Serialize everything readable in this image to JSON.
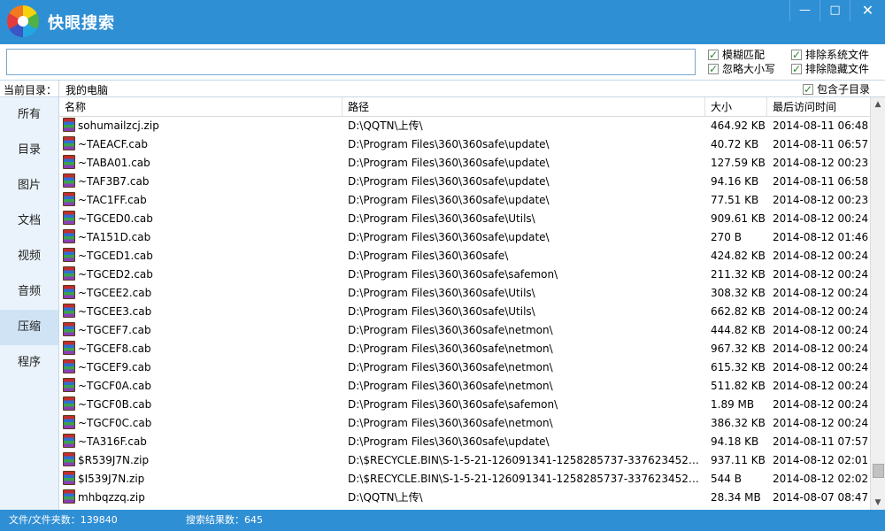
{
  "window": {
    "title": "快眼搜索",
    "controls": {
      "minimize": "—",
      "maximize": "□",
      "close": "✕"
    }
  },
  "search": {
    "value": "",
    "options": [
      {
        "label": "模糊匹配",
        "checked": true
      },
      {
        "label": "排除系统文件",
        "checked": true
      },
      {
        "label": "忽略大小写",
        "checked": true
      },
      {
        "label": "排除隐藏文件",
        "checked": true
      }
    ]
  },
  "directory": {
    "label": "当前目录：",
    "value": "我的电脑",
    "include_subdirs": {
      "label": "包含子目录",
      "checked": true
    }
  },
  "sidebar": {
    "items": [
      {
        "label": "所有"
      },
      {
        "label": "目录"
      },
      {
        "label": "图片"
      },
      {
        "label": "文档"
      },
      {
        "label": "视频"
      },
      {
        "label": "音频"
      },
      {
        "label": "压缩",
        "active": true
      },
      {
        "label": "程序"
      }
    ]
  },
  "table": {
    "columns": [
      "名称",
      "路径",
      "大小",
      "最后访问时间"
    ],
    "rows": [
      [
        "sohumailzcj.zip",
        "D:\\QQTN\\上传\\",
        "464.92 KB",
        "2014-08-11 06:48"
      ],
      [
        "~TAEACF.cab",
        "D:\\Program Files\\360\\360safe\\update\\",
        "40.72 KB",
        "2014-08-11 06:57"
      ],
      [
        "~TABA01.cab",
        "D:\\Program Files\\360\\360safe\\update\\",
        "127.59 KB",
        "2014-08-12 00:23"
      ],
      [
        "~TAF3B7.cab",
        "D:\\Program Files\\360\\360safe\\update\\",
        "94.16 KB",
        "2014-08-11 06:58"
      ],
      [
        "~TAC1FF.cab",
        "D:\\Program Files\\360\\360safe\\update\\",
        "77.51 KB",
        "2014-08-12 00:23"
      ],
      [
        "~TGCED0.cab",
        "D:\\Program Files\\360\\360safe\\Utils\\",
        "909.61 KB",
        "2014-08-12 00:24"
      ],
      [
        "~TA151D.cab",
        "D:\\Program Files\\360\\360safe\\update\\",
        "270 B",
        "2014-08-12 01:46"
      ],
      [
        "~TGCED1.cab",
        "D:\\Program Files\\360\\360safe\\",
        "424.82 KB",
        "2014-08-12 00:24"
      ],
      [
        "~TGCED2.cab",
        "D:\\Program Files\\360\\360safe\\safemon\\",
        "211.32 KB",
        "2014-08-12 00:24"
      ],
      [
        "~TGCEE2.cab",
        "D:\\Program Files\\360\\360safe\\Utils\\",
        "308.32 KB",
        "2014-08-12 00:24"
      ],
      [
        "~TGCEE3.cab",
        "D:\\Program Files\\360\\360safe\\Utils\\",
        "662.82 KB",
        "2014-08-12 00:24"
      ],
      [
        "~TGCEF7.cab",
        "D:\\Program Files\\360\\360safe\\netmon\\",
        "444.82 KB",
        "2014-08-12 00:24"
      ],
      [
        "~TGCEF8.cab",
        "D:\\Program Files\\360\\360safe\\netmon\\",
        "967.32 KB",
        "2014-08-12 00:24"
      ],
      [
        "~TGCEF9.cab",
        "D:\\Program Files\\360\\360safe\\netmon\\",
        "615.32 KB",
        "2014-08-12 00:24"
      ],
      [
        "~TGCF0A.cab",
        "D:\\Program Files\\360\\360safe\\netmon\\",
        "511.82 KB",
        "2014-08-12 00:24"
      ],
      [
        "~TGCF0B.cab",
        "D:\\Program Files\\360\\360safe\\safemon\\",
        "1.89 MB",
        "2014-08-12 00:24"
      ],
      [
        "~TGCF0C.cab",
        "D:\\Program Files\\360\\360safe\\netmon\\",
        "386.32 KB",
        "2014-08-12 00:24"
      ],
      [
        "~TA316F.cab",
        "D:\\Program Files\\360\\360safe\\update\\",
        "94.18 KB",
        "2014-08-11 07:57"
      ],
      [
        "$R539J7N.zip",
        "D:\\$RECYCLE.BIN\\S-1-5-21-126091341-1258285737-3376234526-5...",
        "937.11 KB",
        "2014-08-12 02:01"
      ],
      [
        "$I539J7N.zip",
        "D:\\$RECYCLE.BIN\\S-1-5-21-126091341-1258285737-3376234526-5...",
        "544 B",
        "2014-08-12 02:02"
      ],
      [
        "mhbqzzq.zip",
        "D:\\QQTN\\上传\\",
        "28.34 MB",
        "2014-08-07 08:47"
      ]
    ]
  },
  "status": {
    "files": "文件/文件夹数：139840",
    "results": "搜索结果数：645"
  },
  "icons": {
    "app": "colorwheel-logo-icon",
    "file": "winrar-archive-icon"
  },
  "colors": {
    "accent": "#2f8fd4",
    "sidebar_bg": "#eaf3fb",
    "sidebar_active": "#cfe3f5"
  }
}
